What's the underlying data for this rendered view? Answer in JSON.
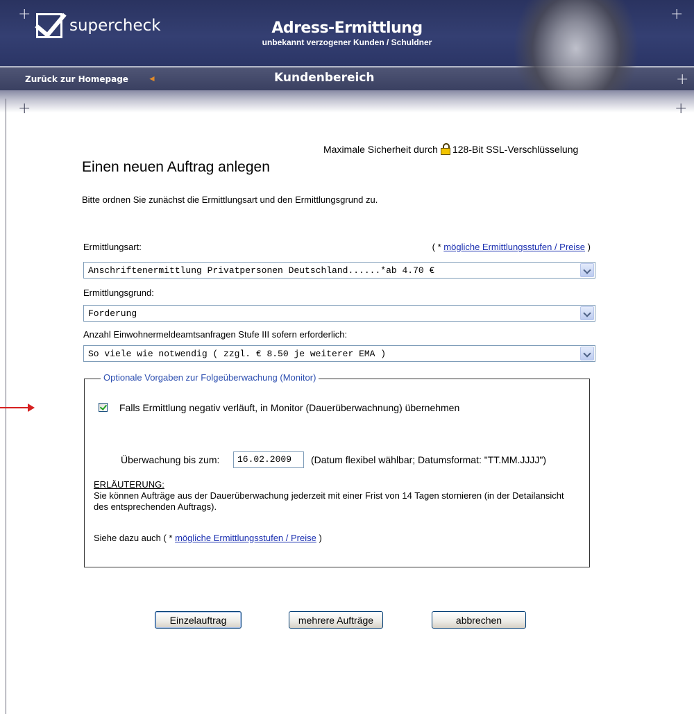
{
  "header": {
    "logo_text": "supercheck",
    "title": "Adress-Ermittlung",
    "subtitle": "unbekannt verzogener Kunden / Schuldner",
    "back_link": "Zurück zur Homepage",
    "section": "Kundenbereich"
  },
  "main": {
    "ssl_prefix": "Maximale Sicherheit durch",
    "ssl_suffix": "128-Bit SSL-Verschlüsselung",
    "page_title": "Einen neuen Auftrag anlegen",
    "intro": "Bitte ordnen Sie zunächst die Ermittlungsart und den Ermittlungsgrund zu.",
    "ermittlungsart_label": "Ermittlungsart:",
    "price_link_prefix": "( * ",
    "price_link": "mögliche Ermittlungsstufen / Preise",
    "price_link_suffix": " )",
    "ermittlungsart_value": "Anschriftenermittlung Privatpersonen Deutschland......*ab 4.70 €",
    "ermittlungsgrund_label": "Ermittlungsgrund:",
    "ermittlungsgrund_value": "Forderung",
    "ema_label": "Anzahl Einwohnermeldeamtsanfragen Stufe III sofern erforderlich:",
    "ema_value": "So viele wie notwendig ( zzgl. € 8.50 je weiterer EMA )",
    "monitor": {
      "legend": "Optionale Vorgaben zur Folgeüberwachung (Monitor)",
      "checkbox_label": "Falls Ermittlung negativ verläuft, in Monitor (Dauerüberwachnung) übernehmen",
      "checked": true,
      "date_label": "Überwachung bis zum:",
      "date_value": "16.02.2009",
      "date_hint": "(Datum flexibel wählbar; Datumsformat: \"TT.MM.JJJJ\")",
      "explanation_heading": "ERLÄUTERUNG:",
      "explanation_text": "Sie können Aufträge aus der Dauerüberwachung jederzeit mit einer Frist von 14 Tagen stornieren (in der Detailansicht des entsprechenden Auftrags).",
      "see_also_prefix": "Siehe dazu auch ( * ",
      "see_also_link": "mögliche Ermittlungsstufen / Preise",
      "see_also_suffix": " )"
    }
  },
  "buttons": {
    "single": "Einzelauftrag",
    "multiple": "mehrere Aufträge",
    "cancel": "abbrechen"
  },
  "colors": {
    "header_bg": "#2e3b6b",
    "link": "#1a2fb0",
    "legend": "#2d4fb0",
    "pointer_arrow": "#d62020"
  }
}
